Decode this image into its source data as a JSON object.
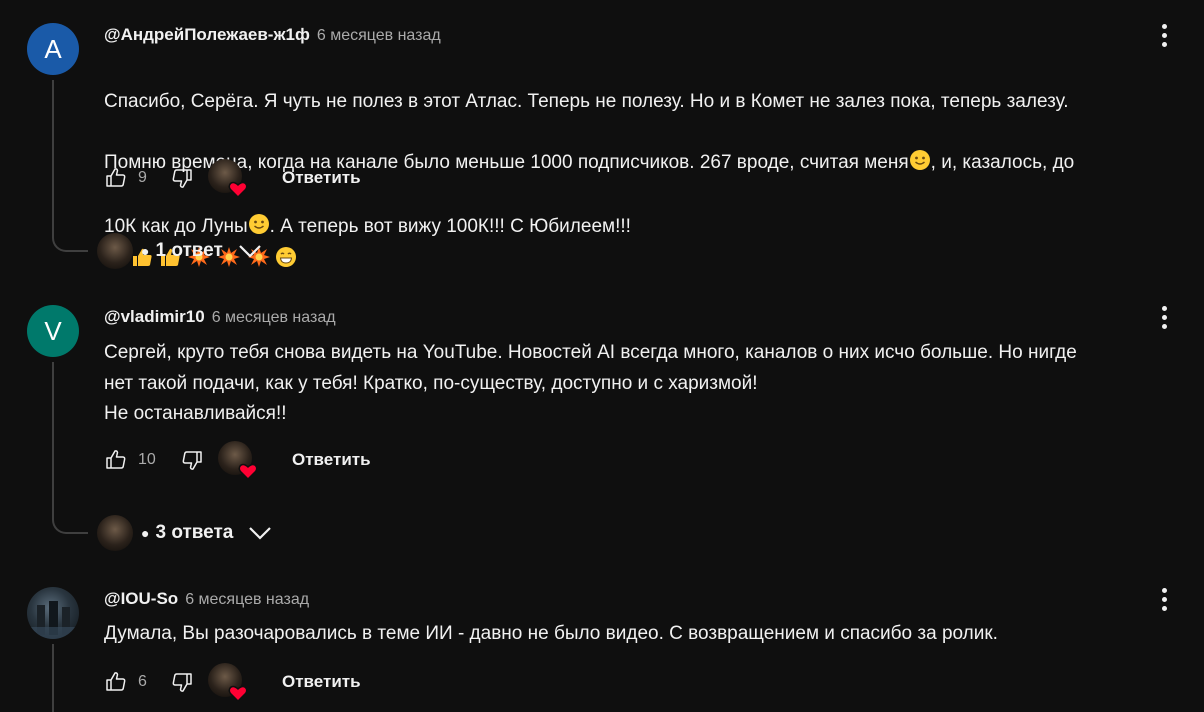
{
  "comments": [
    {
      "avatar_letter": "A",
      "avatar_color": "#1a5aa8",
      "author": "@АндрейПолежаев-ж1ф",
      "time": "6 месяцев назад",
      "text_lines": [
        "Спасибо, Серёга. Я чуть не полез в этот Атлас. Теперь не полезу. Но и в Комет не залез пока, теперь залезу.",
        "Помню времена, когда на канале было меньше 1000 подписчиков. 267 вроде, считая меня",
        ", и, казалось, до",
        "10К как до Луны",
        ". А теперь вот вижу 100К!!! С Юбилеем!!!"
      ],
      "likes": "9",
      "reply_label": "Ответить",
      "replies_label": "1 ответ"
    },
    {
      "avatar_letter": "V",
      "avatar_color": "#00796b",
      "author": "@vladimir10",
      "time": "6 месяцев назад",
      "text": "Сергей, круто тебя снова видеть на YouTube. Новостей AI всегда много, каналов о них исчо больше. Но нигде\nнет такой подачи, как у тебя! Кратко, по-существу, доступно и с харизмой!\nНе останавливайся!!",
      "likes": "10",
      "reply_label": "Ответить",
      "replies_label": "3 ответа"
    },
    {
      "author": "@IOU-So",
      "time": "6 месяцев назад",
      "text": "Думала, Вы разочаровались в теме ИИ - давно не было видео. С возвращением и спасибо за ролик.",
      "likes": "6",
      "reply_label": "Ответить"
    }
  ],
  "colors": {
    "background": "#0f0f0f",
    "text": "#f1f1f1",
    "muted": "#aaaaaa",
    "heart": "#ff0033",
    "thread": "#3f3f3f"
  },
  "icons": [
    "like-icon",
    "dislike-icon",
    "heart-icon",
    "more-vert-icon",
    "chevron-down-icon"
  ]
}
